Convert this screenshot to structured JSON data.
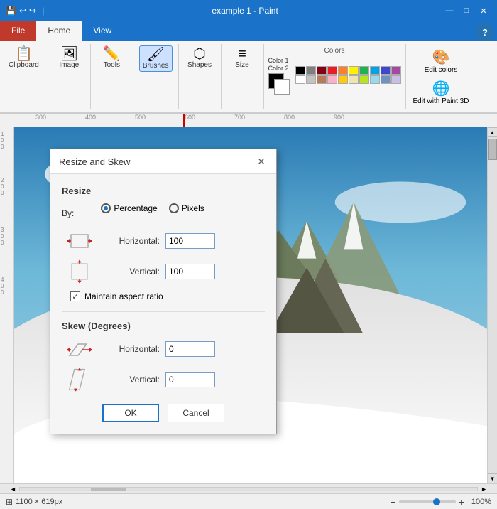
{
  "titleBar": {
    "title": "example 1 - Paint",
    "quickAccessIcons": [
      "💾",
      "↩",
      "↪"
    ],
    "controls": [
      "—",
      "□",
      "✕"
    ]
  },
  "ribbon": {
    "tabs": [
      "File",
      "Home",
      "View"
    ],
    "activeTab": "Home",
    "groups": [
      {
        "name": "Clipboard",
        "items": [
          {
            "icon": "📋",
            "label": "Clipboard"
          }
        ]
      },
      {
        "name": "Image",
        "items": [
          {
            "icon": "🖼",
            "label": "Image"
          }
        ]
      },
      {
        "name": "Tools",
        "items": [
          {
            "icon": "✏️",
            "label": "Tools"
          }
        ]
      },
      {
        "name": "Brushes",
        "items": [
          {
            "icon": "🖌",
            "label": "Brushes"
          }
        ]
      },
      {
        "name": "Shapes",
        "items": [
          {
            "icon": "⬡",
            "label": "Shapes"
          }
        ]
      },
      {
        "name": "Size",
        "items": [
          {
            "icon": "≡",
            "label": "Size"
          }
        ]
      }
    ],
    "colors": {
      "color1Label": "Color 1",
      "color2Label": "Color 2",
      "editColorsLabel": "Edit colors",
      "editPaint3DLabel": "Edit with Paint 3D",
      "colorsLabel": "Colors",
      "swatches": [
        "#000000",
        "#7f7f7f",
        "#880015",
        "#ed1c24",
        "#ff7f27",
        "#fff200",
        "#22b14c",
        "#00a2e8",
        "#3f48cc",
        "#a349a4",
        "#ffffff",
        "#c3c3c3",
        "#b97a57",
        "#ffaec9",
        "#ffc90e",
        "#efe4b0",
        "#b5e61d",
        "#99d9ea",
        "#7092be",
        "#c8bfe7"
      ]
    }
  },
  "ruler": {
    "marks": [
      "300",
      "400",
      "500",
      "600",
      "700",
      "800",
      "900"
    ]
  },
  "statusBar": {
    "dimensions": "1100 × 619px",
    "zoom": "100%",
    "zoomPercent": 100
  },
  "dialog": {
    "title": "Resize and Skew",
    "sections": {
      "resize": {
        "label": "Resize",
        "byLabel": "By:",
        "options": [
          "Percentage",
          "Pixels"
        ],
        "selectedOption": "Percentage",
        "horizontalLabel": "Horizontal:",
        "horizontalValue": "100",
        "verticalLabel": "Vertical:",
        "verticalValue": "100",
        "maintainAspect": "Maintain aspect ratio",
        "maintainChecked": true
      },
      "skew": {
        "label": "Skew (Degrees)",
        "horizontalLabel": "Horizontal:",
        "horizontalValue": "0",
        "verticalLabel": "Vertical:",
        "verticalValue": "0"
      }
    },
    "okLabel": "OK",
    "cancelLabel": "Cancel"
  }
}
